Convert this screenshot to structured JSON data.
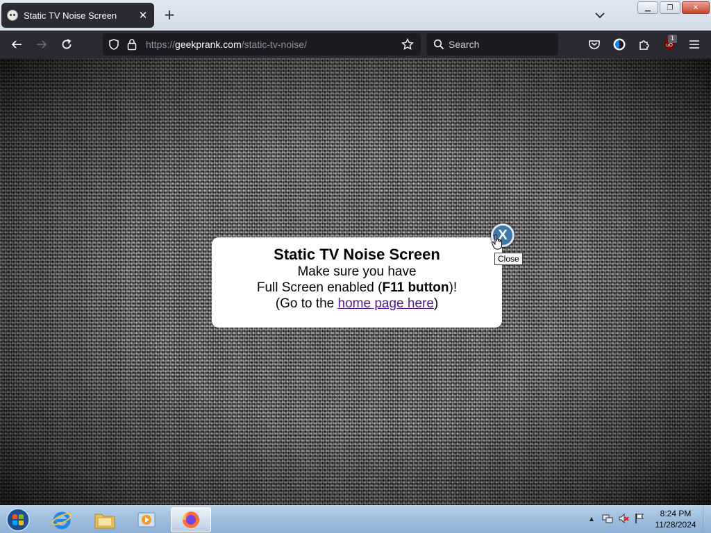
{
  "browser": {
    "tab": {
      "title": "Static TV Noise Screen",
      "close_glyph": "✕"
    },
    "new_tab_glyph": "+",
    "window_controls": {
      "minimize": "▁",
      "maximize": "❐",
      "close": "✕"
    },
    "url": {
      "scheme": "https://",
      "host": "geekprank.com",
      "path": "/static-tv-noise/"
    },
    "search": {
      "placeholder": "Search"
    },
    "extension_badge": "1"
  },
  "page": {
    "title": "Static TV Noise Screen",
    "line1": "Make sure you have",
    "line2_prefix": "Full Screen enabled (",
    "line2_bold": "F11 button",
    "line2_suffix": ")!",
    "line3_prefix": "(Go to the ",
    "line3_link": "home page here",
    "line3_suffix": ")",
    "close_button": "X",
    "close_tooltip": "Close"
  },
  "taskbar": {
    "time": "8:24 PM",
    "date": "11/28/2024",
    "tray_arrow": "▲",
    "active_app": "Firefox"
  }
}
